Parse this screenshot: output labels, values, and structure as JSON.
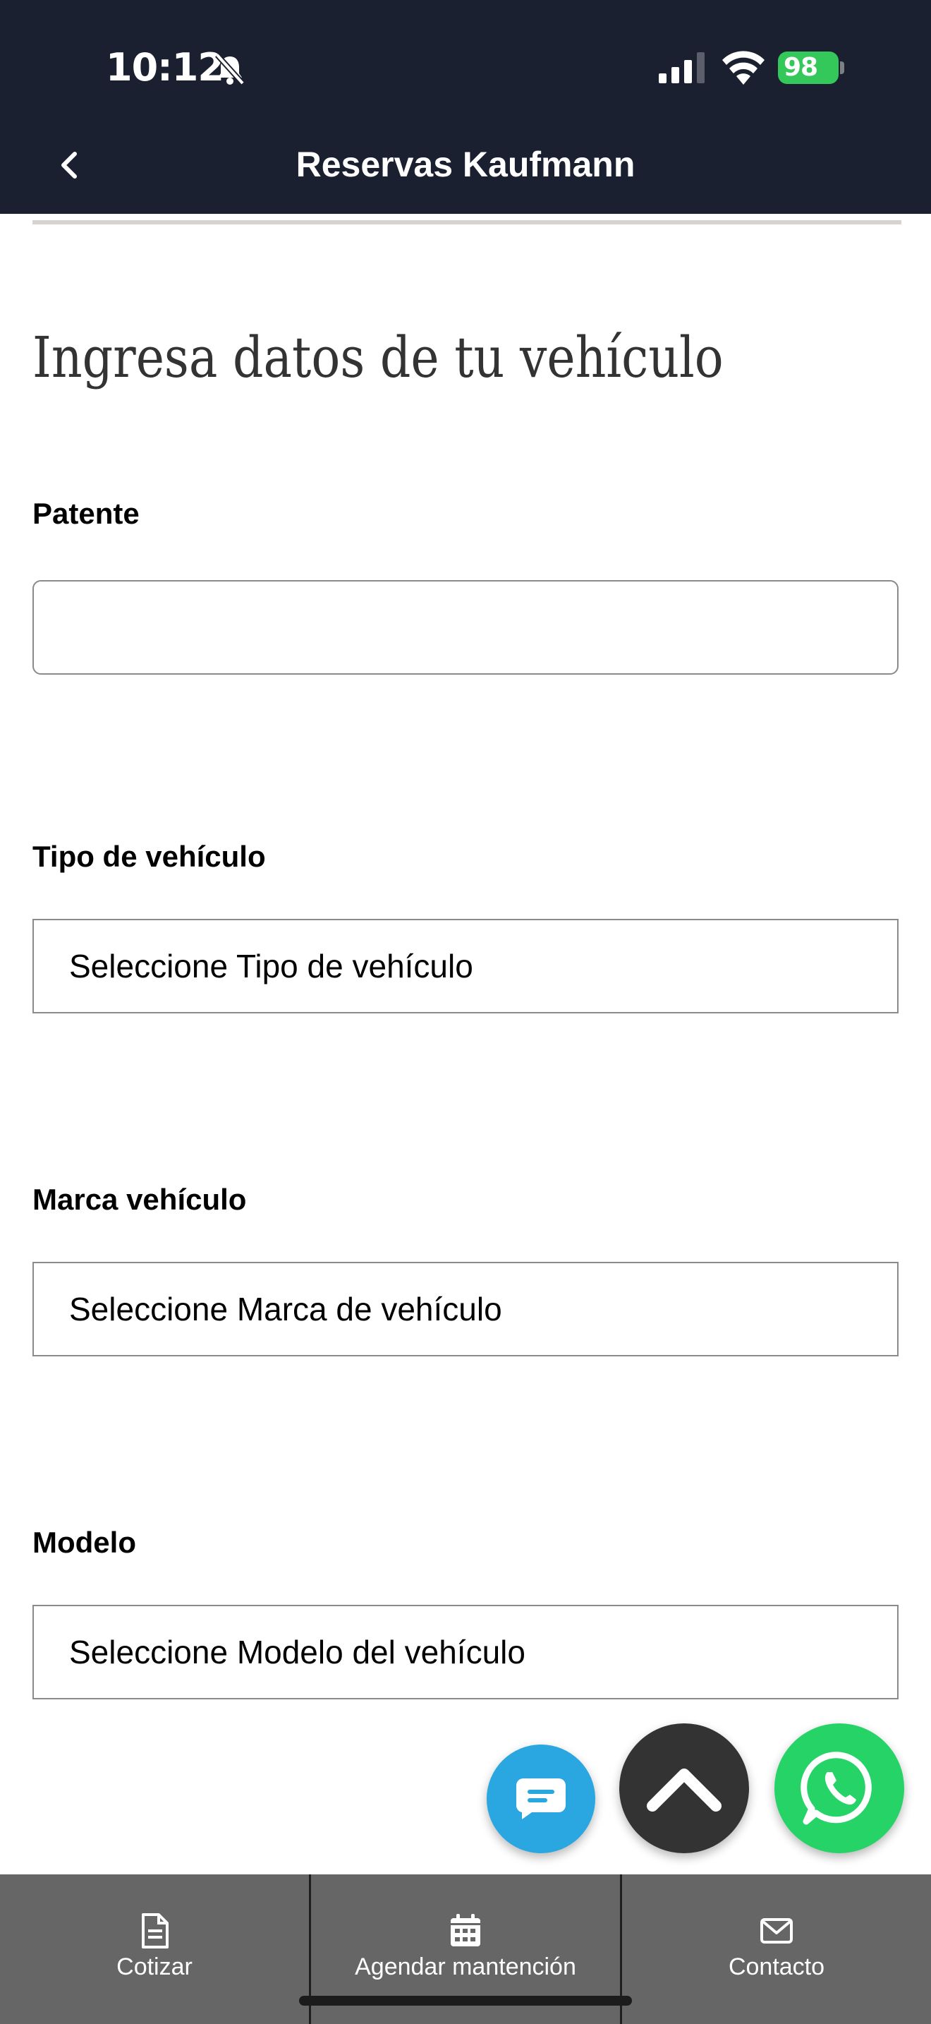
{
  "status_bar": {
    "time": "10:12",
    "battery": "98"
  },
  "header": {
    "title": "Reservas Kaufmann"
  },
  "form": {
    "title": "Ingresa datos de tu vehículo",
    "patente": {
      "label": "Patente",
      "value": "",
      "placeholder": ""
    },
    "tipo": {
      "label": "Tipo de vehículo",
      "selected": "Seleccione Tipo de vehículo"
    },
    "marca": {
      "label": "Marca vehículo",
      "selected": "Seleccione Marca de vehículo"
    },
    "modelo": {
      "label": "Modelo",
      "selected": "Seleccione Modelo del vehículo"
    }
  },
  "bottom_nav": {
    "items": [
      {
        "label": "Cotizar",
        "icon": "document-icon"
      },
      {
        "label": "Agendar mantención",
        "icon": "calendar-icon"
      },
      {
        "label": "Contacto",
        "icon": "envelope-icon"
      }
    ]
  },
  "colors": {
    "header_bg": "#1a2030",
    "battery": "#34c759",
    "chat_fab": "#2aa7e0",
    "scroll_top_fab": "#333333",
    "whatsapp_fab": "#25d366",
    "bottom_nav_bg": "#666666"
  }
}
